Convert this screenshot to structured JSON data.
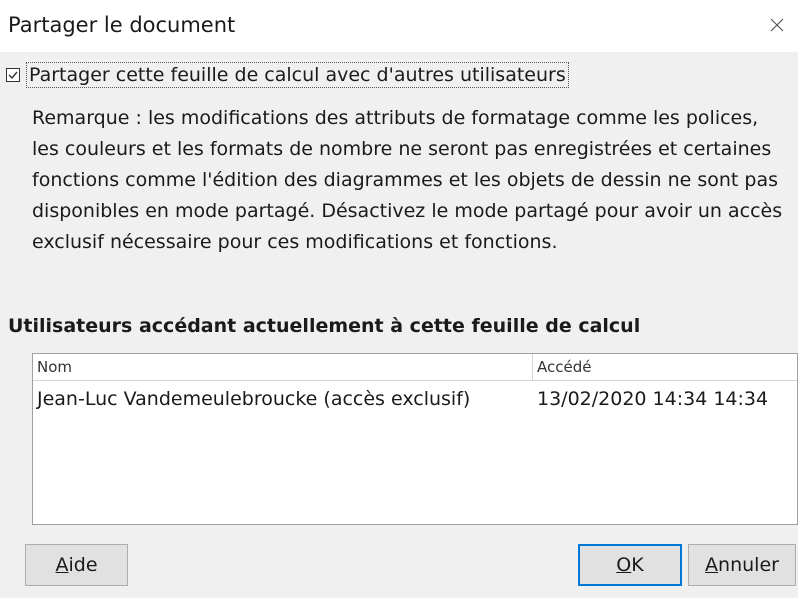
{
  "dialog": {
    "title": "Partager le document"
  },
  "share": {
    "checked": true,
    "checkbox_label": "Partager cette feuille de calcul avec d'autres utilisateurs",
    "note": "Remarque : les modifications des attributs de formatage comme les polices, les couleurs et les formats de nombre ne seront pas enregistrées et certaines fonctions comme l'édition des diagrammes et les objets de dessin ne sont pas disponibles en mode partagé. Désactivez le mode partagé pour avoir un accès exclusif nécessaire pour ces modifications et fonctions."
  },
  "users": {
    "section_title": "Utilisateurs accédant actuellement à cette feuille de calcul",
    "columns": [
      "Nom",
      "Accédé"
    ],
    "rows": [
      {
        "name": "Jean-Luc Vandemeulebroucke (accès exclusif)",
        "accessed": "13/02/2020 14:34 14:34"
      }
    ]
  },
  "buttons": {
    "help": {
      "mnemonic": "A",
      "rest": "ide"
    },
    "ok": {
      "mnemonic": "O",
      "rest": "K"
    },
    "cancel": {
      "mnemonic": "A",
      "rest": "nnuler"
    }
  },
  "icons": {
    "checkbox": "checkmark-icon",
    "close": "close-icon"
  },
  "colors": {
    "focus_border": "#0078d7",
    "dialog_background": "#f0f0f0"
  }
}
